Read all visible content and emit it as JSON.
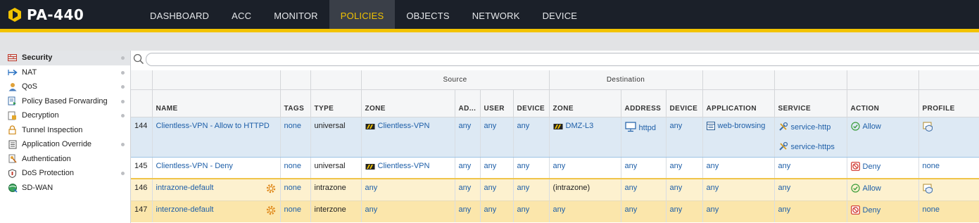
{
  "app": {
    "title": "PA-440"
  },
  "nav": [
    {
      "label": "DASHBOARD",
      "active": false
    },
    {
      "label": "ACC",
      "active": false
    },
    {
      "label": "MONITOR",
      "active": false
    },
    {
      "label": "POLICIES",
      "active": true
    },
    {
      "label": "OBJECTS",
      "active": false
    },
    {
      "label": "NETWORK",
      "active": false
    },
    {
      "label": "DEVICE",
      "active": false
    }
  ],
  "sidebar": {
    "items": [
      {
        "label": "Security",
        "icon": "security-rule-icon",
        "active": true,
        "dot": true
      },
      {
        "label": "NAT",
        "icon": "nat-arrow-icon",
        "active": false,
        "dot": true
      },
      {
        "label": "QoS",
        "icon": "qos-users-icon",
        "active": false,
        "dot": true
      },
      {
        "label": "Policy Based Forwarding",
        "icon": "pbf-icon",
        "active": false,
        "dot": true
      },
      {
        "label": "Decryption",
        "icon": "decryption-lock-icon",
        "active": false,
        "dot": true
      },
      {
        "label": "Tunnel Inspection",
        "icon": "tunnel-lock-icon",
        "active": false,
        "dot": false
      },
      {
        "label": "Application Override",
        "icon": "app-override-icon",
        "active": false,
        "dot": true
      },
      {
        "label": "Authentication",
        "icon": "authentication-icon",
        "active": false,
        "dot": false
      },
      {
        "label": "DoS Protection",
        "icon": "dos-shield-icon",
        "active": false,
        "dot": true
      },
      {
        "label": "SD-WAN",
        "icon": "sdwan-globe-icon",
        "active": false,
        "dot": false
      }
    ]
  },
  "search": {
    "placeholder": "",
    "value": ""
  },
  "table": {
    "group_headers": {
      "source": "Source",
      "destination": "Destination"
    },
    "columns": {
      "name": "NAME",
      "tags": "TAGS",
      "type": "TYPE",
      "src_zone": "ZONE",
      "src_address": "AD...",
      "src_user": "USER",
      "src_device": "DEVICE",
      "dst_zone": "ZONE",
      "dst_address": "ADDRESS",
      "dst_device": "DEVICE",
      "application": "APPLICATION",
      "service": "SERVICE",
      "action": "ACTION",
      "profile": "PROFILE"
    },
    "rows": [
      {
        "num": "144",
        "name": "Clientless-VPN - Allow to HTTPD",
        "tags": "none",
        "type": "universal",
        "src_zone": "Clientless-VPN",
        "src_address": "any",
        "src_user": "any",
        "src_device": "any",
        "dst_zone": "DMZ-L3",
        "dst_address": "httpd",
        "dst_device": "any",
        "application": "web-browsing",
        "service": [
          "service-http",
          "service-https"
        ],
        "action": "Allow",
        "profile": ""
      },
      {
        "num": "145",
        "name": "Clientless-VPN - Deny",
        "tags": "none",
        "type": "universal",
        "src_zone": "Clientless-VPN",
        "src_address": "any",
        "src_user": "any",
        "src_device": "any",
        "dst_zone": "any",
        "dst_address": "any",
        "dst_device": "any",
        "application": "any",
        "service": [
          "any"
        ],
        "action": "Deny",
        "profile": "none"
      },
      {
        "num": "146",
        "name": "intrazone-default",
        "tags": "none",
        "type": "intrazone",
        "src_zone": "any",
        "src_address": "any",
        "src_user": "any",
        "src_device": "any",
        "dst_zone": "(intrazone)",
        "dst_address": "any",
        "dst_device": "any",
        "application": "any",
        "service": [
          "any"
        ],
        "action": "Allow",
        "profile": ""
      },
      {
        "num": "147",
        "name": "interzone-default",
        "tags": "none",
        "type": "interzone",
        "src_zone": "any",
        "src_address": "any",
        "src_user": "any",
        "src_device": "any",
        "dst_zone": "any",
        "dst_address": "any",
        "dst_device": "any",
        "application": "any",
        "service": [
          "any"
        ],
        "action": "Deny",
        "profile": "none"
      }
    ]
  },
  "colors": {
    "accent": "#f2c300",
    "topbar": "#1b2029",
    "link": "#1e5fa8",
    "allow": "#3a9d3a",
    "deny": "#d0342c"
  }
}
